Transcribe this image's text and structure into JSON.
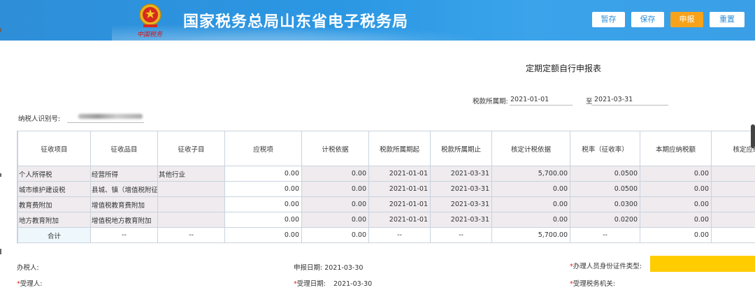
{
  "header": {
    "site_title": "国家税务总局山东省电子税务局",
    "slogan": "中国税务",
    "buttons": {
      "temp_save": "暂存",
      "save": "保存",
      "submit": "申报",
      "reset": "重置"
    }
  },
  "form": {
    "title": "定期定额自行申报表",
    "period_label": "税款所属期:",
    "period_start": "2021-01-01",
    "period_to": "至",
    "period_end": "2021-03-31",
    "taxpayer_id_label": "纳税人识别号:"
  },
  "table": {
    "headers": [
      "征收项目",
      "征收品目",
      "征收子目",
      "应税项",
      "计税依据",
      "税款所属期起",
      "税款所属期止",
      "核定计税依据",
      "税率（征收率）",
      "本期应纳税额",
      "核定应纳"
    ],
    "rows": [
      [
        "个人所得税",
        "经营所得",
        "其他行业",
        "0.00",
        "0.00",
        "2021-01-01",
        "2021-03-31",
        "5,700.00",
        "0.0500",
        "0.00",
        ""
      ],
      [
        "城市维护建设税",
        "县城、镇（增值税附征",
        "",
        "0.00",
        "0.00",
        "2021-01-01",
        "2021-03-31",
        "0.00",
        "0.0500",
        "0.00",
        ""
      ],
      [
        "教育费附加",
        "增值税教育费附加",
        "",
        "0.00",
        "0.00",
        "2021-01-01",
        "2021-03-31",
        "0.00",
        "0.0300",
        "0.00",
        ""
      ],
      [
        "地方教育附加",
        "增值税地方教育附加",
        "",
        "0.00",
        "0.00",
        "2021-01-01",
        "2021-03-31",
        "0.00",
        "0.0200",
        "0.00",
        ""
      ]
    ],
    "total": [
      "合计",
      "--",
      "--",
      "0.00",
      "0.00",
      "--",
      "--",
      "5,700.00",
      "--",
      "0.00",
      ""
    ]
  },
  "footer": {
    "agent_label": "办税人:",
    "declare_date_label": "申报日期:",
    "declare_date": "2021-03-30",
    "id_type_label": "办理人员身份证件类型:",
    "receiver_label": "受理人:",
    "receive_date_label": "受理日期:",
    "receive_date": "2021-03-30",
    "tax_authority_label": "受理税务机关:"
  },
  "colors": {
    "header_blue": "#2b97e3",
    "submit_orange": "#f7a21b",
    "required_red": "#e02020",
    "highlight_yellow": "#ffcc00"
  }
}
